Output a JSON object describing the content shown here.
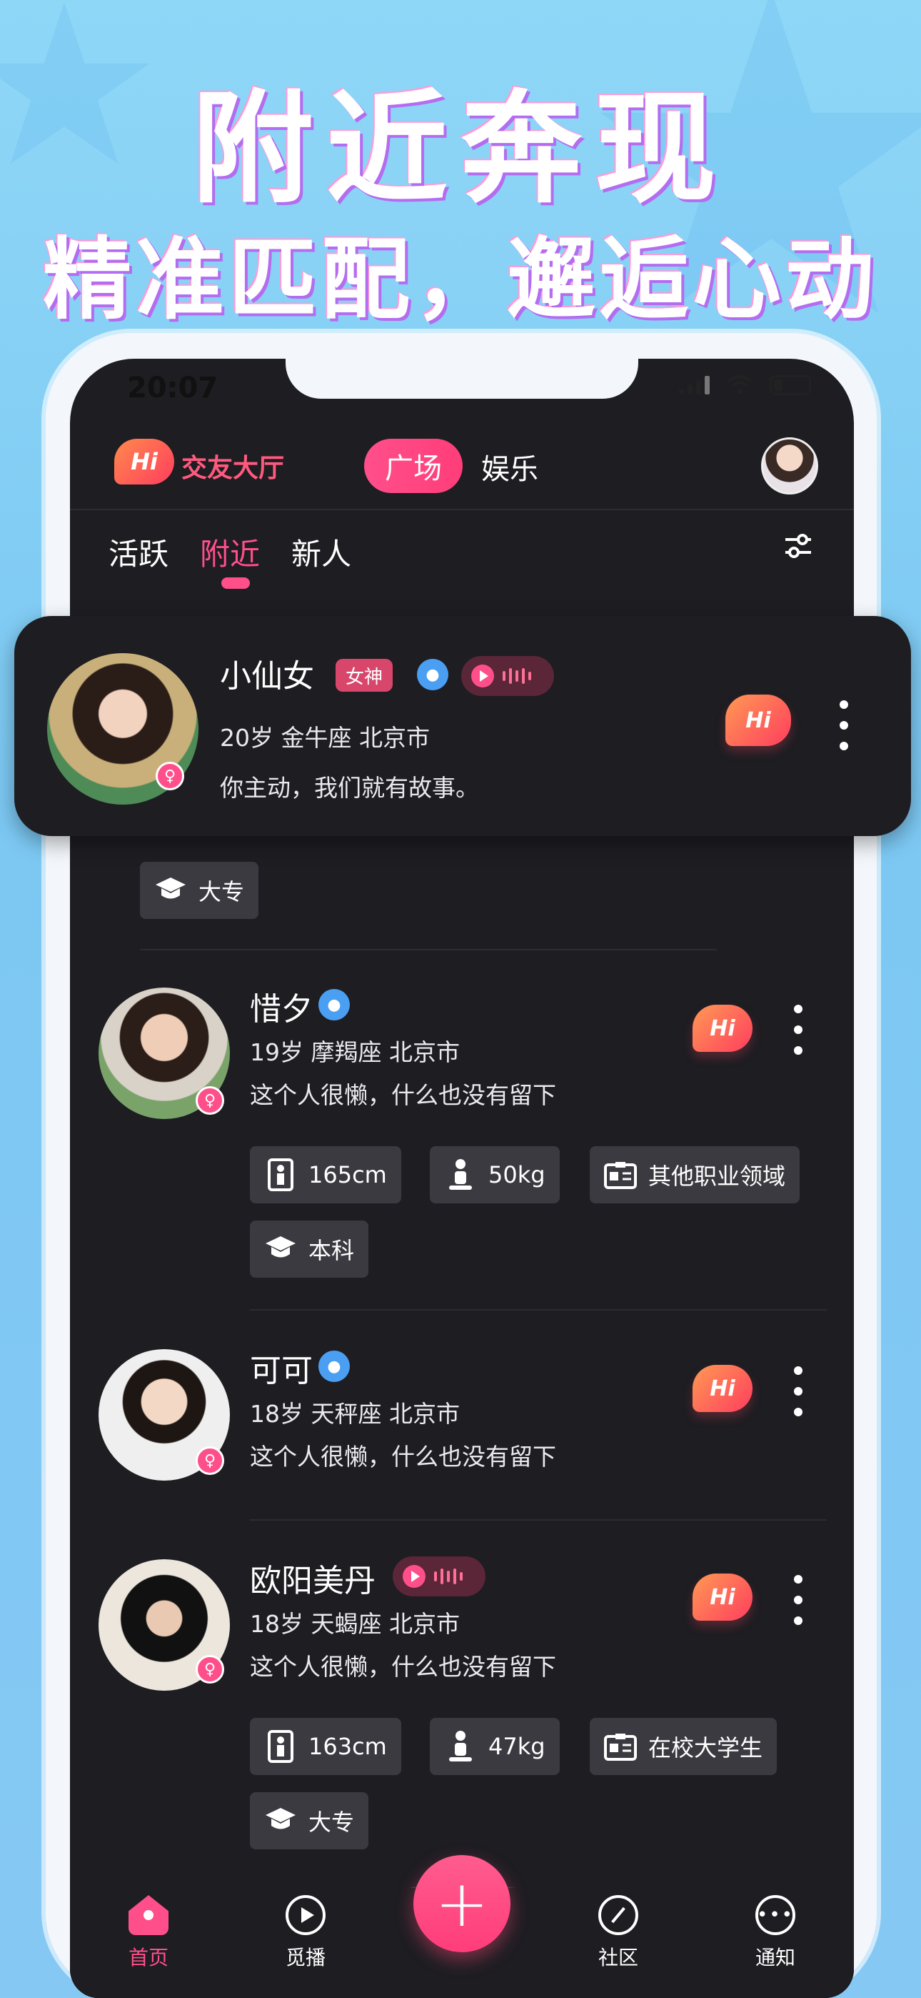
{
  "promo": {
    "title": "附近奔现",
    "subtitle": "精准匹配，邂逅心动"
  },
  "status_bar": {
    "time": "20:07"
  },
  "header": {
    "logo_text": "Hi",
    "lobby_label": "交友大厅",
    "segments": [
      {
        "label": "广场",
        "active": true
      },
      {
        "label": "娱乐",
        "active": false
      }
    ]
  },
  "tabs": [
    {
      "label": "活跃",
      "active": false
    },
    {
      "label": "附近",
      "active": true
    },
    {
      "label": "新人",
      "active": false
    }
  ],
  "featured": {
    "name": "小仙女",
    "badge": "女神",
    "meta": "20岁   金牛座   北京市",
    "bio": "你主动，我们就有故事。",
    "hi": "Hi"
  },
  "users": [
    {
      "name": "惜夕",
      "meta": "19岁   摩羯座   北京市",
      "bio": "这个人很懒，什么也没有留下",
      "hi": "Hi",
      "tags": {
        "height": "165cm",
        "weight": "50kg",
        "job": "其他职业领域",
        "edu": "本科"
      }
    },
    {
      "name": "可可",
      "meta": "18岁   天秤座   北京市",
      "bio": "这个人很懒，什么也没有留下",
      "hi": "Hi"
    },
    {
      "name": "欧阳美丹",
      "meta": "18岁   天蝎座   北京市",
      "bio": "这个人很懒，什么也没有留下",
      "hi": "Hi",
      "tags": {
        "height": "163cm",
        "weight": "47kg",
        "job": "在校大学生",
        "edu": "大专"
      }
    }
  ],
  "partial_row": {
    "edu": "大专"
  },
  "bottom_nav": [
    {
      "label": "首页",
      "icon": "home-icon",
      "active": true
    },
    {
      "label": "觅播",
      "icon": "play-icon",
      "active": false
    },
    {
      "label": "社区",
      "icon": "compass-icon",
      "active": false
    },
    {
      "label": "通知",
      "icon": "chat-icon",
      "active": false
    }
  ],
  "fab": {
    "icon": "plus-icon",
    "label": "+"
  },
  "colors": {
    "accent": "#ff4f8b",
    "background": "#1d1d22",
    "sky": "#8fd7f7"
  }
}
